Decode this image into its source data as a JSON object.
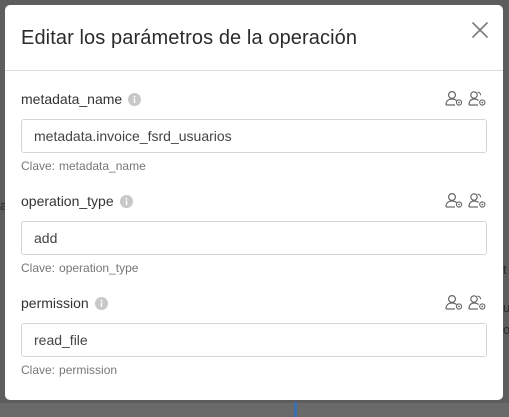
{
  "modal": {
    "title": "Editar los parámetros de la operación"
  },
  "fields": [
    {
      "label": "metadata_name",
      "value": "metadata.invoice_fsrd_usuarios",
      "key_prefix": "Clave:",
      "key": "metadata_name"
    },
    {
      "label": "operation_type",
      "value": "add",
      "key_prefix": "Clave:",
      "key": "operation_type"
    },
    {
      "label": "permission",
      "value": "read_file",
      "key_prefix": "Clave:",
      "key": "permission"
    }
  ],
  "icons": {
    "close": "close-icon",
    "info": "info-icon",
    "user_settings": "user-settings-icon",
    "group_settings": "group-settings-icon"
  },
  "colors": {
    "overlay": "#5d5d5d",
    "modal_bg": "#ffffff",
    "border": "#d5d5d5",
    "text": "#333333",
    "hint": "#777777"
  }
}
